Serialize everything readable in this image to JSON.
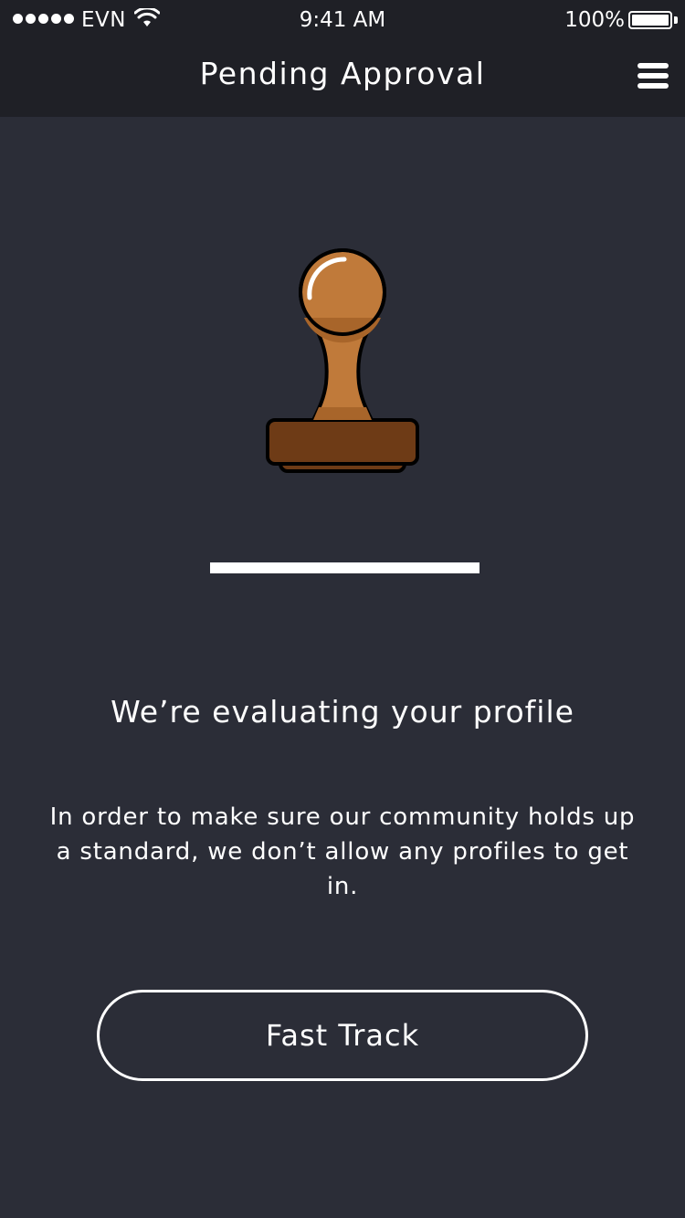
{
  "status_bar": {
    "carrier": "EVN",
    "time": "9:41 AM",
    "battery_percent": "100%",
    "battery_level": 1.0,
    "signal_bars": 5
  },
  "nav": {
    "title": "Pending Approval",
    "menu_icon": "hamburger-menu-icon"
  },
  "illustration": {
    "icon": "rubber-stamp-icon",
    "colors": {
      "handle": "#c07a3a",
      "handle_shade": "#a8652a",
      "base": "#6e3b16",
      "outline": "#000000"
    }
  },
  "progress": {
    "value": 1.0
  },
  "content": {
    "headline": "We’re evaluating your profile",
    "body": "In order to make sure our community holds up a standard, we don’t allow any profiles to get in."
  },
  "cta": {
    "label": "Fast Track"
  },
  "colors": {
    "background": "#2b2d37",
    "topbar": "#1f2026",
    "text": "#ffffff"
  }
}
